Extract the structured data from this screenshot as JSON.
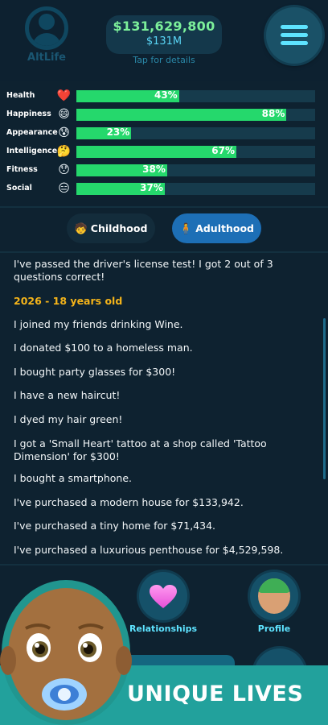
{
  "header": {
    "logo_text": "AltLife",
    "money": "$131,629,800",
    "money_short": "$131M",
    "tap_hint": "Tap for details",
    "menu_icon": "hamburger-menu-icon"
  },
  "stats": [
    {
      "label": "Health",
      "emoji": "❤️",
      "icon": "heart-icon",
      "value": 43,
      "text": "43%"
    },
    {
      "label": "Happiness",
      "emoji": "😄",
      "icon": "grin-face-icon",
      "value": 88,
      "text": "88%"
    },
    {
      "label": "Appearance",
      "emoji": "😰",
      "icon": "anxious-face-icon",
      "value": 23,
      "text": "23%"
    },
    {
      "label": "Intelligence",
      "emoji": "🤔",
      "icon": "thinking-face-icon",
      "value": 67,
      "text": "67%"
    },
    {
      "label": "Fitness",
      "emoji": "😯",
      "icon": "surprised-face-icon",
      "value": 38,
      "text": "38%"
    },
    {
      "label": "Social",
      "emoji": "😑",
      "icon": "expressionless-face-icon",
      "value": 37,
      "text": "37%"
    }
  ],
  "tabs": {
    "childhood": "Childhood",
    "adulthood": "Adulthood"
  },
  "log": [
    {
      "type": "text",
      "text": "I've passed the driver's license test! I got 2 out of 3 questions correct!"
    },
    {
      "type": "year",
      "text": "2026 - 18 years old"
    },
    {
      "type": "text",
      "text": "I joined my friends drinking Wine."
    },
    {
      "type": "text",
      "text": "I donated $100 to a homeless man."
    },
    {
      "type": "text",
      "text": "I bought party glasses for $300!"
    },
    {
      "type": "text",
      "text": "I have a new haircut!"
    },
    {
      "type": "text",
      "text": "I dyed my hair green!"
    },
    {
      "type": "text",
      "text": "I got a 'Small Heart' tattoo at a shop called 'Tattoo Dimension' for $300!"
    },
    {
      "type": "text",
      "text": "I bought a smartphone."
    },
    {
      "type": "text",
      "text": "I've purchased a modern house for $133,942."
    },
    {
      "type": "text",
      "text": "I've purchased a tiny home for $71,434."
    },
    {
      "type": "text",
      "text": "I've purchased a luxurious penthouse for $4,529,598."
    }
  ],
  "nav": {
    "relationships": "Relationships",
    "profile": "Profile"
  },
  "promo": {
    "text": "UNIQUE LIVES"
  },
  "colors": {
    "background": "#0e2230",
    "bar_fill": "#25d86c",
    "bar_track": "#163b4c",
    "accent_cyan": "#5ee3ff",
    "money_green": "#7cf09a",
    "year_gold": "#f4b41a",
    "tab_active": "#1d6fb6",
    "promo_teal": "#22a19c"
  }
}
